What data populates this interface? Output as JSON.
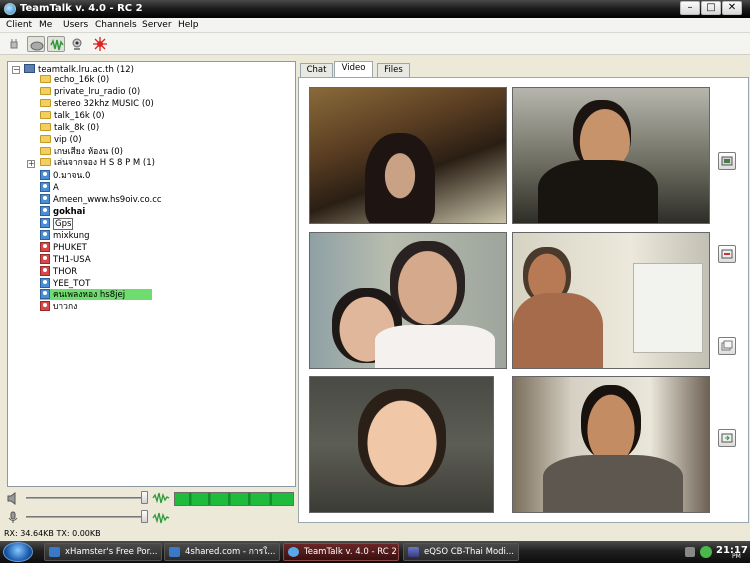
{
  "window": {
    "title": "TeamTalk v. 4.0 - RC 2"
  },
  "menu": [
    "Client",
    "Me",
    "Users",
    "Channels",
    "Server",
    "Help"
  ],
  "toolbar": {
    "icons": [
      "plug-icon",
      "speaker-icon",
      "voice-activation-icon",
      "webcam-icon",
      "desktop-share-icon"
    ]
  },
  "tree": {
    "root": "teamtalk.lru.ac.th (12)",
    "channels": [
      "echo_16k (0)",
      "private_lru_radio (0)",
      "stereo 32khz MUSIC (0)",
      "talk_16k (0)",
      "talk_8k (0)",
      "vip (0)",
      "เกษเสียง ห้องน (0)",
      "เล่นจากจอง H S 8 P M (1)"
    ],
    "users": [
      "0.มาจน.0",
      "A",
      "Ameen_www.hs9oiv.co.cc",
      "gokhai",
      "Gps",
      "mixkung",
      "PHUKET",
      "TH1-USA",
      "THOR",
      "YEE_TOT",
      "คนเพลงหอง  hs8jej",
      "บาวกง"
    ]
  },
  "status": {
    "text": "RX: 34.64KB TX: 0.00KB"
  },
  "tabs": [
    "Chat",
    "Video",
    "Files"
  ],
  "taskbar": {
    "tasks": [
      "xHamster's Free Por...",
      "4shared.com - การใ...",
      "TeamTalk v. 4.0 - RC 2",
      "eQSO CB-Thai Modi..."
    ],
    "time": "21:17",
    "ampm": "PM"
  }
}
